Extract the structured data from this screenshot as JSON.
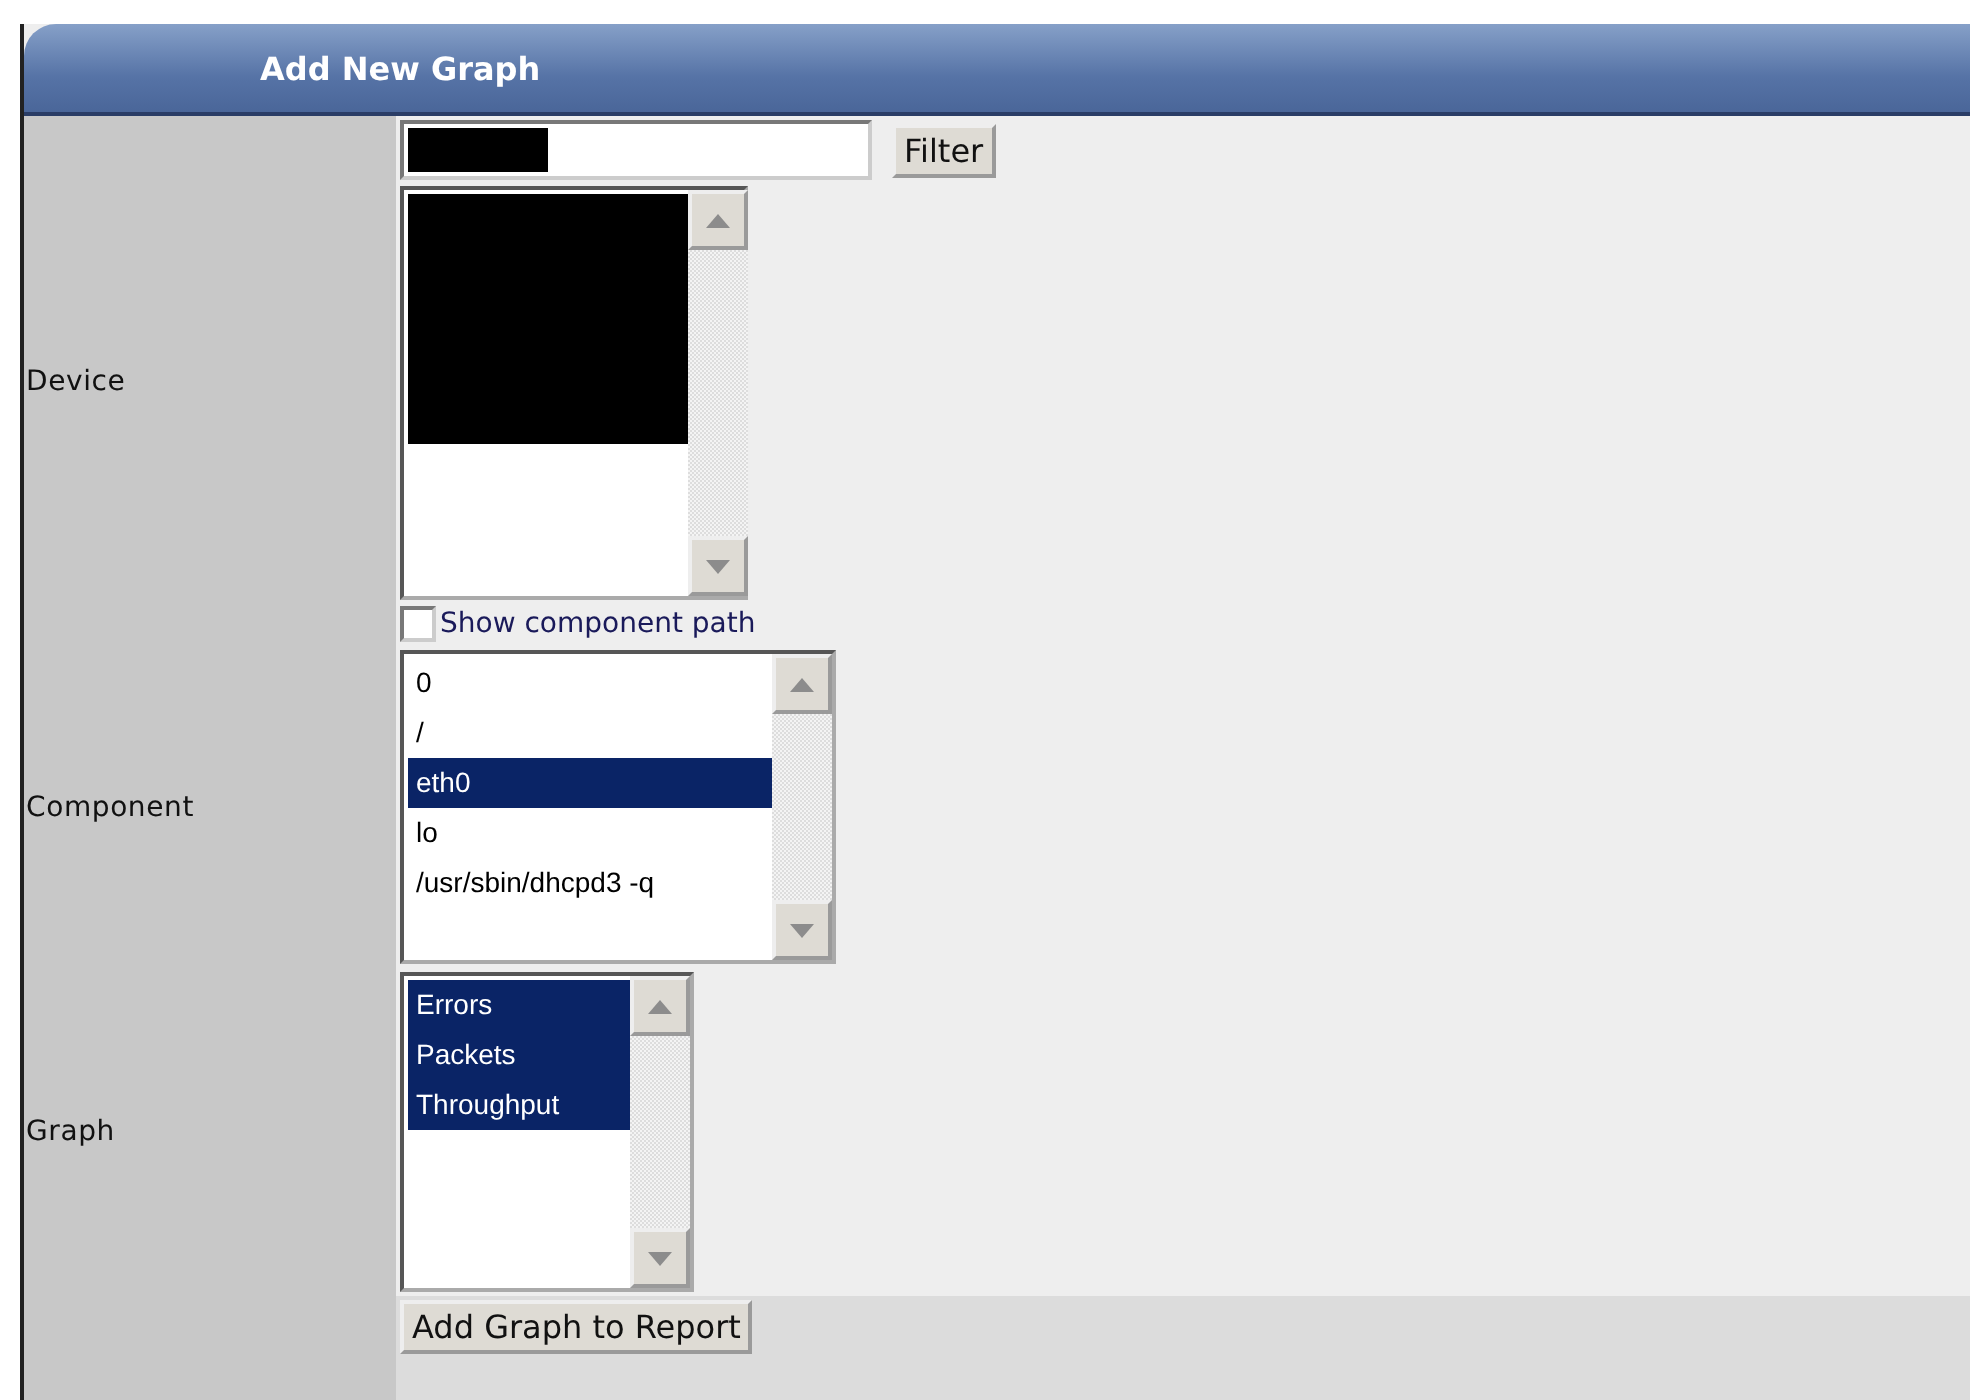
{
  "panel": {
    "title": "Add New Graph"
  },
  "device": {
    "label": "Device",
    "filter_button": "Filter",
    "show_path_option": {
      "label": "Show component path",
      "checked": false
    }
  },
  "component": {
    "label": "Component",
    "items": [
      {
        "text": "0",
        "selected": false
      },
      {
        "text": "/",
        "selected": false
      },
      {
        "text": "eth0",
        "selected": true
      },
      {
        "text": "lo",
        "selected": false
      },
      {
        "text": "/usr/sbin/dhcpd3 -q",
        "selected": false
      }
    ]
  },
  "graph": {
    "label": "Graph",
    "items": [
      {
        "text": "Errors",
        "selected": true
      },
      {
        "text": "Packets",
        "selected": true
      },
      {
        "text": "Throughput",
        "selected": true
      }
    ]
  },
  "submit_button": "Add Graph to Report"
}
